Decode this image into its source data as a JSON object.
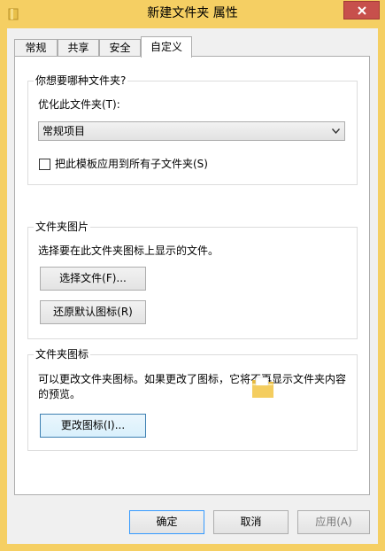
{
  "window": {
    "title": "新建文件夹 属性"
  },
  "tabs": [
    {
      "label": "常规",
      "active": false
    },
    {
      "label": "共享",
      "active": false
    },
    {
      "label": "安全",
      "active": false
    },
    {
      "label": "自定义",
      "active": true
    }
  ],
  "folder_type": {
    "group_title": "你想要哪种文件夹?",
    "optimize_label": "优化此文件夹(T):",
    "selected_value": "常规项目",
    "checkbox_label": "把此模板应用到所有子文件夹(S)",
    "checkbox_checked": false
  },
  "folder_picture": {
    "group_title": "文件夹图片",
    "description": "选择要在此文件夹图标上显示的文件。",
    "choose_file_label": "选择文件(F)...",
    "restore_default_label": "还原默认图标(R)"
  },
  "folder_icon": {
    "group_title": "文件夹图标",
    "description_line1": "可以更改文件夹图标。如果更改了图标，它将不再显示文件夹内容",
    "description_line2": "的预览。",
    "change_icon_label": "更改图标(I)..."
  },
  "footer": {
    "ok_label": "确定",
    "cancel_label": "取消",
    "apply_label": "应用(A)"
  },
  "colors": {
    "frame": "#F5CF63",
    "close_button": "#C7504C",
    "client_bg": "#F0F0F0",
    "focus_border": "#3C7FB1"
  }
}
